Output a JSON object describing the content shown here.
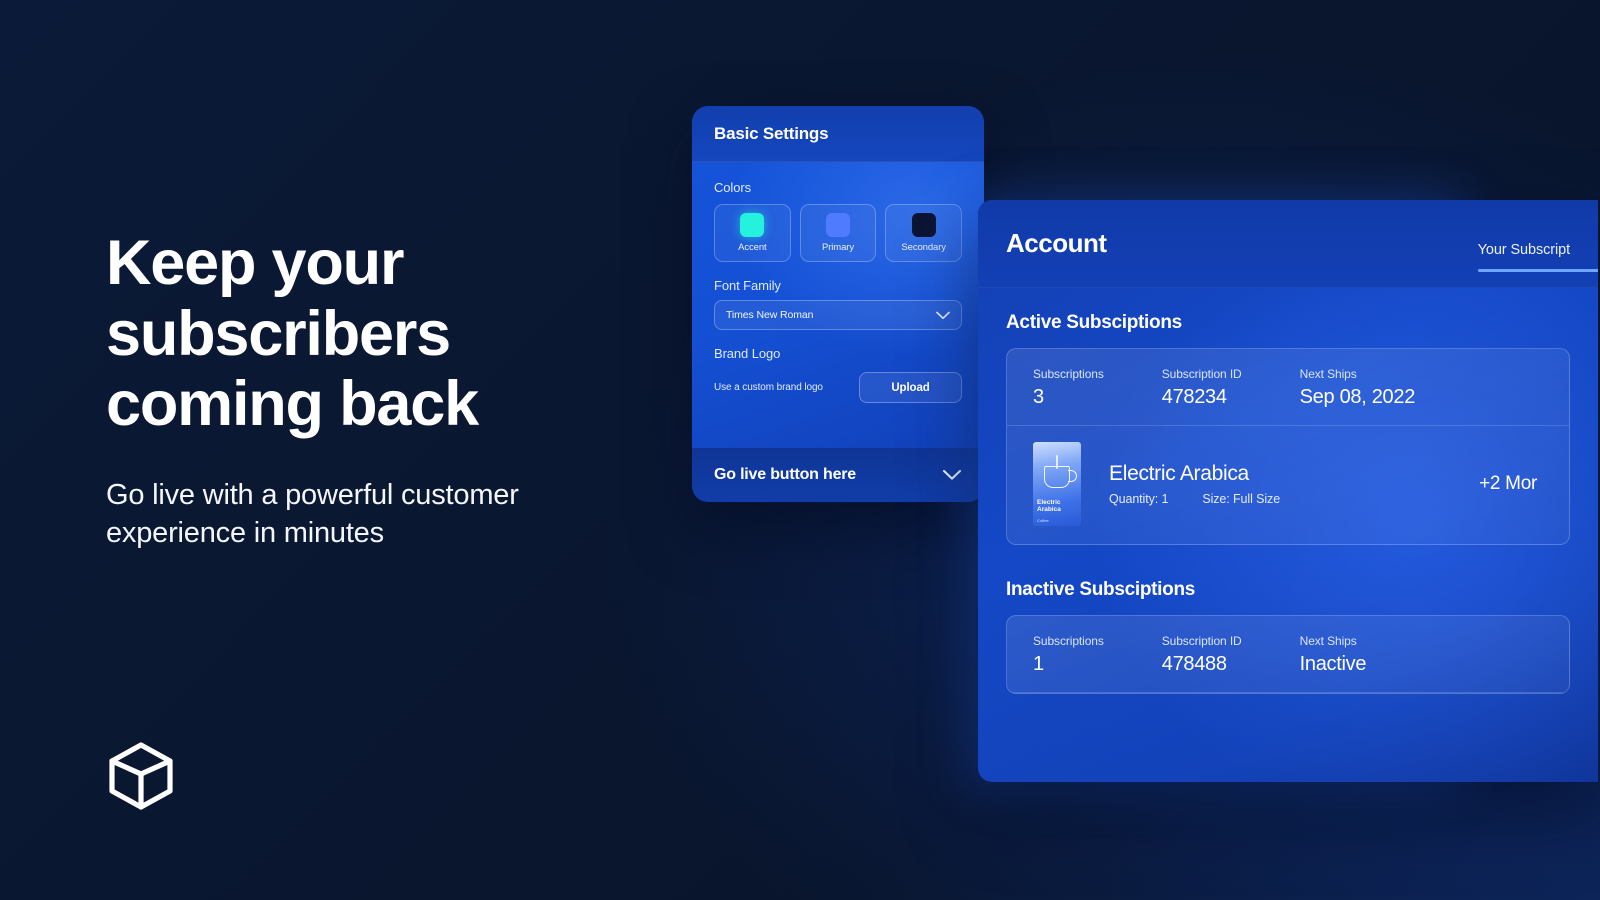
{
  "hero": {
    "headline_lines": [
      "Keep your",
      "subscribers",
      "coming back"
    ],
    "subhead": "Go live with a powerful customer experience in minutes",
    "logo_icon": "cube-box-icon"
  },
  "settings_panel": {
    "title": "Basic Settings",
    "colors": {
      "label": "Colors",
      "swatches": [
        {
          "name": "Accent",
          "hex": "#25F2DD"
        },
        {
          "name": "Primary",
          "hex": "#4E7BFF"
        },
        {
          "name": "Secondary",
          "hex": "#0C1533"
        }
      ]
    },
    "font_family": {
      "label": "Font Family",
      "value": "Times New Roman",
      "caret_icon": "chevron-down-icon"
    },
    "brand_logo": {
      "label": "Brand Logo",
      "hint": "Use a custom brand logo",
      "upload_label": "Upload"
    },
    "footer": {
      "label": "Go live button here",
      "caret_icon": "chevron-down-icon"
    }
  },
  "account_panel": {
    "title": "Account",
    "tabs": [
      {
        "label": "Your Subscript",
        "active": true
      }
    ],
    "sections": [
      {
        "title": "Active Subsciptions",
        "card": {
          "meta": [
            {
              "key": "Subscriptions",
              "value": "3"
            },
            {
              "key": "Subscription ID",
              "value": "478234"
            },
            {
              "key": "Next Ships",
              "value": "Sep 08, 2022"
            }
          ],
          "item": {
            "thumb_label": "Electric Arabica",
            "thumb_sub": "Coffee",
            "name": "Electric Arabica",
            "quantity": "Quantity: 1",
            "size": "Size: Full Size",
            "more": "+2 Mor"
          }
        }
      },
      {
        "title": "Inactive Subsciptions",
        "card": {
          "meta": [
            {
              "key": "Subscriptions",
              "value": "1"
            },
            {
              "key": "Subscription ID",
              "value": "478488"
            },
            {
              "key": "Next Ships",
              "value": "Inactive"
            }
          ]
        }
      }
    ]
  },
  "theme": {
    "background_dark": "#0A1730",
    "panel_blue": "#1450D4",
    "accent_cyan": "#25F2DD",
    "tab_underline": "#6EA6FF"
  }
}
